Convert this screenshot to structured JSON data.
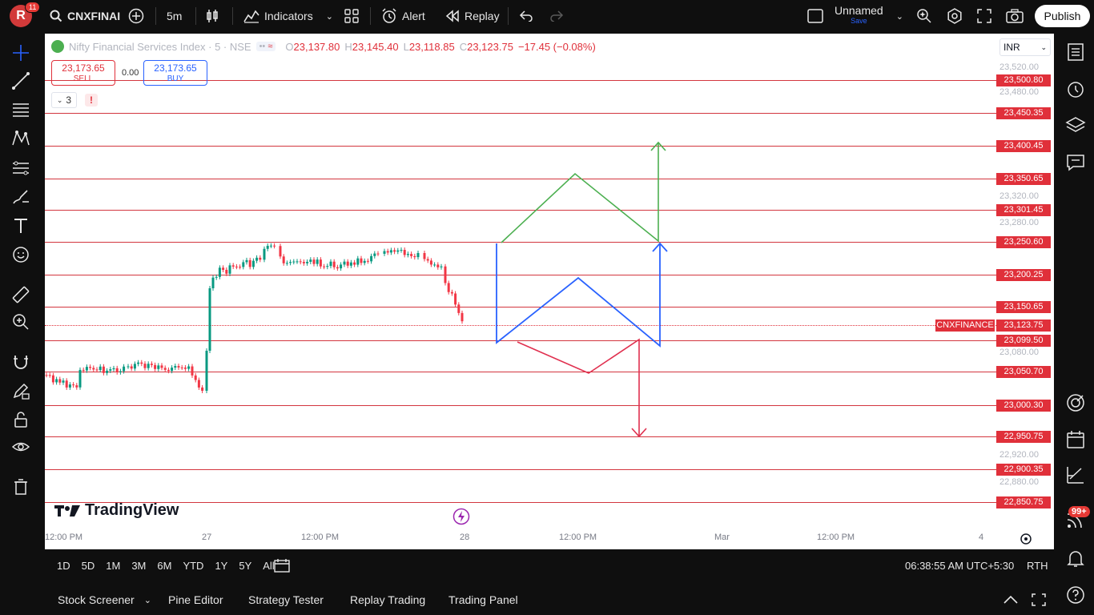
{
  "topbar": {
    "avatar_letter": "R",
    "avatar_badge": "11",
    "symbol": "CNXFINAI",
    "interval": "5m",
    "indicators_label": "Indicators",
    "alert_label": "Alert",
    "replay_label": "Replay",
    "layout_name": "Unnamed",
    "layout_sub": "Save",
    "publish_label": "Publish"
  },
  "legend": {
    "title": "Nifty Financial Services Index · 5 · NSE",
    "o_label": "O",
    "o": "23,137.80",
    "h_label": "H",
    "h": "23,145.40",
    "l_label": "L",
    "l": "23,118.85",
    "c_label": "C",
    "c": "23,123.75",
    "change": "−17.45 (−0.08%)"
  },
  "trade": {
    "sell_price": "23,173.65",
    "sell_label": "SELL",
    "spread": "0.00",
    "buy_price": "23,173.65",
    "buy_label": "BUY",
    "indicator_count": "3",
    "warning": "!"
  },
  "currency": "INR",
  "price_axis_labels": [
    "23,520.00",
    "23,480.00",
    "23,320.00",
    "23,280.00",
    "23,080.00",
    "22,920.00",
    "22,880.00"
  ],
  "price_levels": [
    "23,500.80",
    "23,450.35",
    "23,400.45",
    "23,350.65",
    "23,301.45",
    "23,250.60",
    "23,200.25",
    "23,150.65",
    "23,099.50",
    "23,050.70",
    "23,000.30",
    "22,950.75",
    "22,900.35",
    "22,850.75"
  ],
  "current": {
    "symbol_tag": "CNXFINANCE",
    "price": "23,123.75"
  },
  "time_axis": [
    "12:00 PM",
    "27",
    "12:00 PM",
    "28",
    "12:00 PM",
    "Mar",
    "12:00 PM",
    "4"
  ],
  "logo_text": "TradingView",
  "ranges": [
    "1D",
    "5D",
    "1M",
    "3M",
    "6M",
    "YTD",
    "1Y",
    "5Y",
    "All"
  ],
  "clock": "06:38:55 AM UTC+5:30",
  "session": "RTH",
  "bottom_tabs": [
    "Stock Screener",
    "Pine Editor",
    "Strategy Tester",
    "Replay Trading",
    "Trading Panel"
  ],
  "notif_badge": "99+",
  "colors": {
    "up": "#089981",
    "down": "#f23645",
    "level": "#d3363f",
    "green_path": "#4caf50",
    "blue_path": "#2962ff",
    "red_path": "#e0304f"
  }
}
